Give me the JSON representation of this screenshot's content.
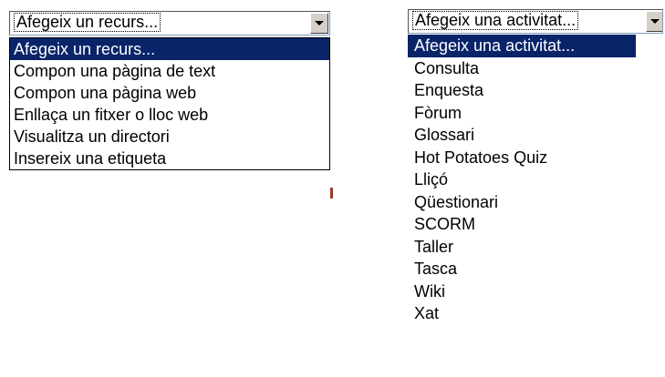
{
  "resource_dropdown": {
    "selected_value": "Afegeix un recurs...",
    "options": [
      "Afegeix un recurs...",
      "Compon una pàgina de text",
      "Compon una pàgina web",
      "Enllaça un fitxer o lloc web",
      "Visualitza un directori",
      "Insereix una etiqueta"
    ],
    "highlighted_index": 0
  },
  "activity_dropdown": {
    "selected_value": "Afegeix una activitat...",
    "options": [
      "Afegeix una activitat...",
      "Consulta",
      "Enquesta",
      "Fòrum",
      "Glossari",
      "Hot Potatoes Quiz",
      "Lliçó",
      "Qüestionari",
      "SCORM",
      "Taller",
      "Tasca",
      "Wiki",
      "Xat"
    ],
    "highlighted_index": 0
  },
  "colors": {
    "highlight_bg": "#0a246a",
    "highlight_text": "#ffffff",
    "accent_mark": "#b03020"
  },
  "icons": {
    "dropdown_arrow": "chevron-down-icon"
  }
}
